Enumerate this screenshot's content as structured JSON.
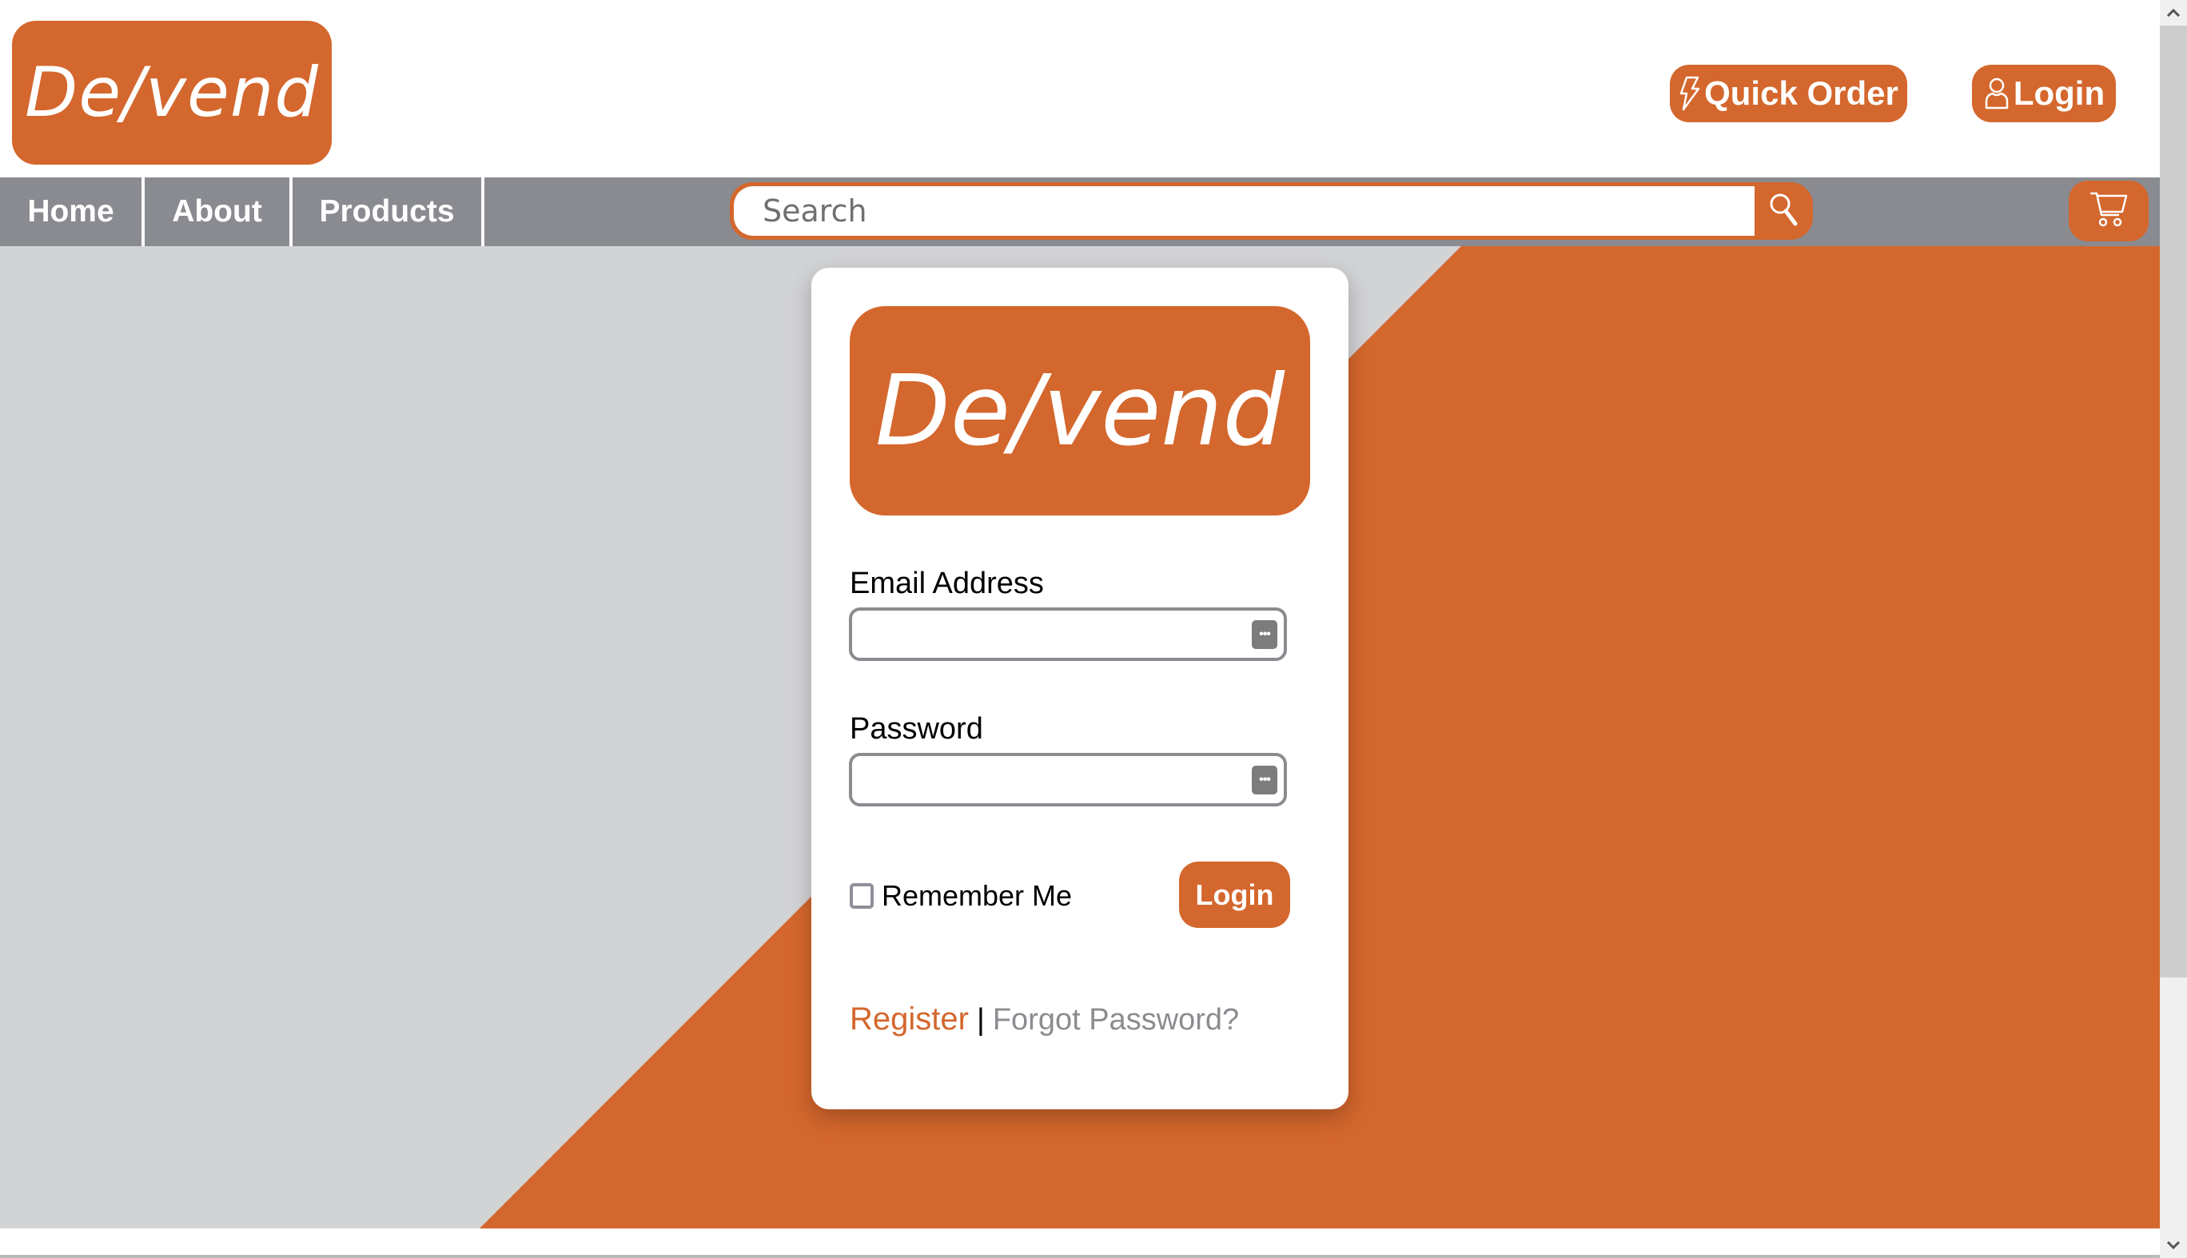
{
  "header": {
    "logo_text": "De/vend",
    "quick_order_label": "Quick Order",
    "login_label": "Login",
    "icons": {
      "quick_order": "lightning-bolt-icon",
      "login": "user-icon"
    }
  },
  "nav": {
    "tabs": [
      {
        "label": "Home"
      },
      {
        "label": "About"
      },
      {
        "label": "Products"
      }
    ],
    "search": {
      "placeholder": "Search",
      "value": ""
    },
    "icons": {
      "search": "search-icon",
      "cart": "cart-icon"
    }
  },
  "login_card": {
    "logo_text": "De/vend",
    "email": {
      "label": "Email Address",
      "value": ""
    },
    "password": {
      "label": "Password",
      "value": ""
    },
    "remember_me": {
      "label": "Remember Me",
      "checked": false
    },
    "submit_label": "Login",
    "register_label": "Register",
    "separator": "|",
    "forgot_label": "Forgot Password?",
    "icons": {
      "password_manager": "password-manager-icon"
    }
  },
  "theme": {
    "accent": "#d4672d",
    "nav_bg": "#898b90",
    "hero_bg": "#d2d3d5",
    "link_muted": "#8a8c90"
  }
}
